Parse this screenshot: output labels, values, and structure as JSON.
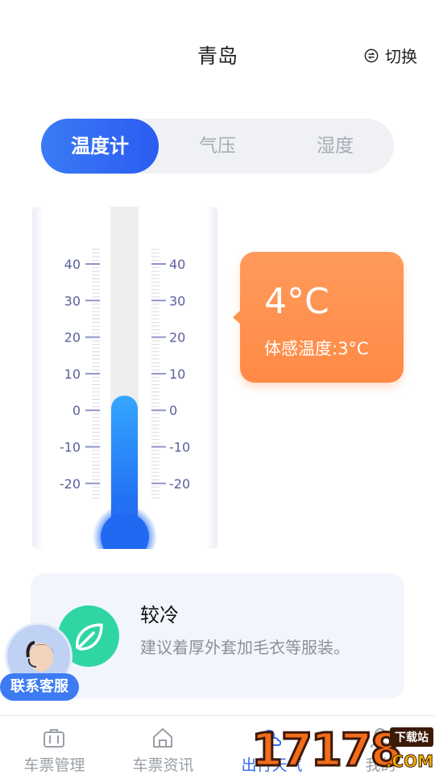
{
  "header": {
    "city": "青岛",
    "switch_label": "切换",
    "switch_icon": "switch-circle-icon"
  },
  "segments": [
    {
      "label": "温度计",
      "active": true
    },
    {
      "label": "气压",
      "active": false
    },
    {
      "label": "湿度",
      "active": false
    }
  ],
  "thermometer": {
    "scale_labels": [
      "40",
      "30",
      "20",
      "10",
      "0",
      "-10",
      "-20"
    ],
    "mercury_level_celsius": 4,
    "mercury_color": "#2f7cf6"
  },
  "reading": {
    "temperature": "4°C",
    "feels_like": "体感温度:3°C",
    "bubble_color": "#ff8f4c"
  },
  "advice": {
    "title": "较冷",
    "text": "建议着厚外套加毛衣等服装。",
    "icon": "leaf-icon",
    "icon_color": "#2fd6a3"
  },
  "customer_service": {
    "label": "联系客服"
  },
  "tabs": [
    {
      "label": "车票管理",
      "icon": "briefcase-icon",
      "active": false
    },
    {
      "label": "车票资讯",
      "icon": "home-icon",
      "active": false
    },
    {
      "label": "出行天气",
      "icon": "weather-icon",
      "active": true
    },
    {
      "label": "我的",
      "icon": "user-icon",
      "active": false
    }
  ],
  "watermark": {
    "number": "17178",
    "tag": "下载站",
    "domain": ".COM"
  }
}
